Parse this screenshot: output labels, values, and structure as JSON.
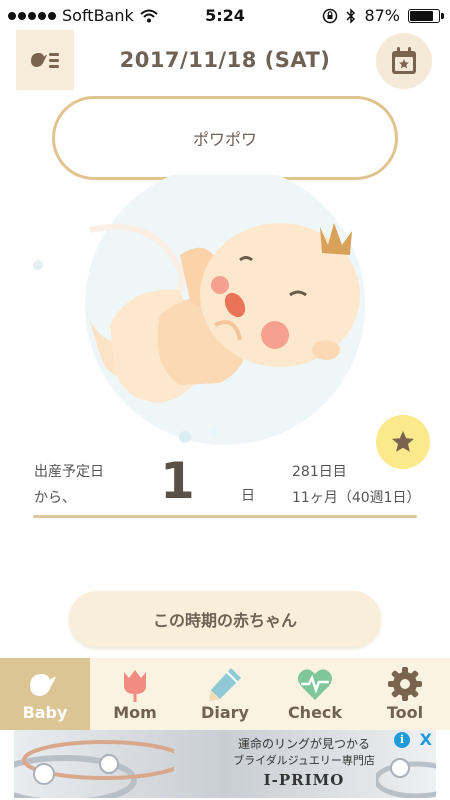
{
  "status_bar": {
    "carrier": "SoftBank",
    "time": "5:24",
    "battery": "87%",
    "battery_level": 0.87
  },
  "header": {
    "date": "2017/11/18 (SAT)"
  },
  "bubble": {
    "text": "ポワポワ"
  },
  "countdown": {
    "label_line1": "出産予定日",
    "label_line2": "から、",
    "value": "1",
    "unit": "日",
    "days_elapsed": "281日目",
    "age": "11ヶ月（40週1日）"
  },
  "info_button": {
    "label": "この時期の赤ちゃん"
  },
  "tabs": [
    {
      "label": "Baby",
      "icon": "bird-icon",
      "active": true
    },
    {
      "label": "Mom",
      "icon": "tulip-icon",
      "active": false
    },
    {
      "label": "Diary",
      "icon": "pencil-icon",
      "active": false
    },
    {
      "label": "Check",
      "icon": "heart-pulse-icon",
      "active": false
    },
    {
      "label": "Tool",
      "icon": "gear-icon",
      "active": false
    }
  ],
  "ad": {
    "line1": "運命のリングが見つかる",
    "line2": "ブライダルジュエリー専門店",
    "brand": "I-PRIMO",
    "info_glyph": "i",
    "close_glyph": "X"
  },
  "colors": {
    "accent": "#dcc594",
    "bubble_border": "#dfc48f",
    "tab_bg": "#fbf3e1",
    "fav_button": "#fbe98b",
    "mom_icon": "#f28b82",
    "diary_icon": "#8fc9d6",
    "check_icon": "#7fc79a",
    "tool_icon": "#7a6450"
  }
}
